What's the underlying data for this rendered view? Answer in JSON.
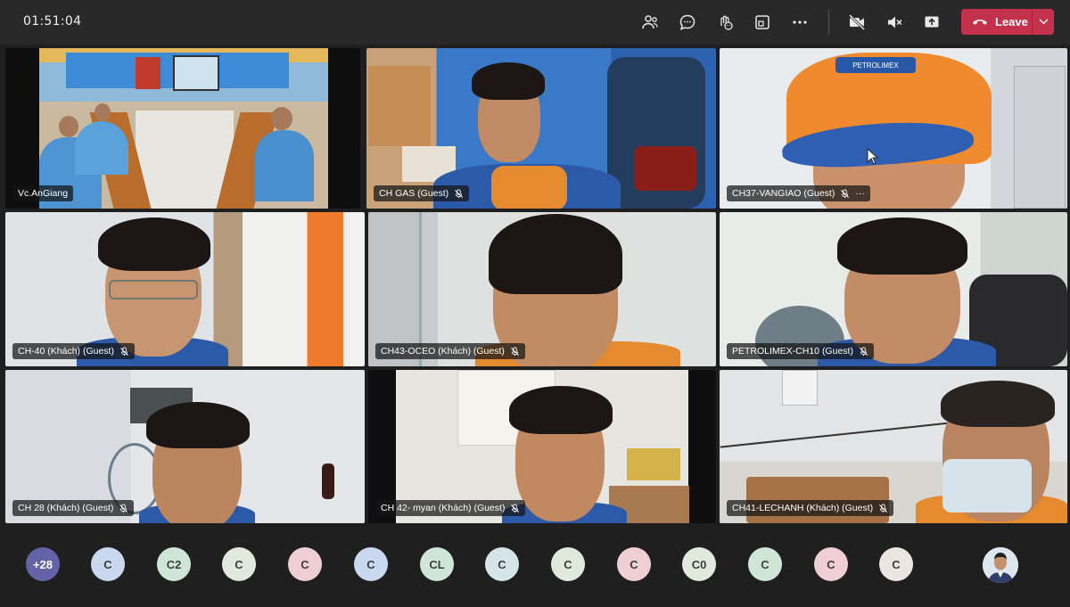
{
  "meeting": {
    "timer": "01:51:04",
    "leave_label": "Leave"
  },
  "toolbar": {
    "icons": [
      "people-icon",
      "chat-icon",
      "reactions-icon",
      "share-tray-icon",
      "more-icon",
      "camera-off-icon",
      "mic-off-icon",
      "share-screen-icon"
    ]
  },
  "tiles": [
    {
      "name": "Vc.AnGiang",
      "muted": false
    },
    {
      "name": "CH GAS (Guest)",
      "muted": true
    },
    {
      "name": "CH37-VANGIAO (Guest)",
      "muted": true,
      "more": "···"
    },
    {
      "name": "CH-40 (Khách) (Guest)",
      "muted": true
    },
    {
      "name": "CH43-OCEO (Khách) (Guest)",
      "muted": true
    },
    {
      "name": "PETROLIMEX-CH10 (Guest)",
      "muted": true
    },
    {
      "name": "CH 28 (Khách) (Guest)",
      "muted": true
    },
    {
      "name": "CH 42- myan (Khách) (Guest)",
      "muted": true
    },
    {
      "name": "CH41-LECHANH (Khách) (Guest)",
      "muted": true
    }
  ],
  "cap_logo": "PETROLIMEX",
  "overflow": {
    "count_label": "+28",
    "participants": [
      {
        "initials": "C",
        "color": "#c9d8ee"
      },
      {
        "initials": "C2",
        "color": "#cfe6d6"
      },
      {
        "initials": "C",
        "color": "#dfe9dc"
      },
      {
        "initials": "C",
        "color": "#efcfd4"
      },
      {
        "initials": "C",
        "color": "#c9d8ee"
      },
      {
        "initials": "CL",
        "color": "#cfe6d6"
      },
      {
        "initials": "C",
        "color": "#d5e3ea"
      },
      {
        "initials": "C",
        "color": "#dfe9dc"
      },
      {
        "initials": "C",
        "color": "#efcfd4"
      },
      {
        "initials": "C0",
        "color": "#dfe9dc"
      },
      {
        "initials": "C",
        "color": "#cfe6d6"
      },
      {
        "initials": "C",
        "color": "#efcfd4"
      },
      {
        "initials": "C",
        "color": "#ece6e0"
      }
    ],
    "count_color": "#6264a7"
  },
  "colors": {
    "leave": "#c4314b",
    "topbar": "#292929",
    "background": "#1f1f1f"
  }
}
